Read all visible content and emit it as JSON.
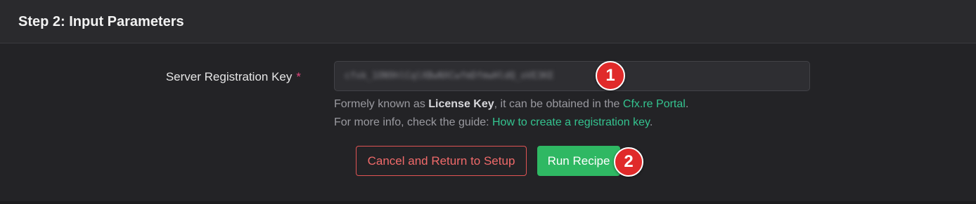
{
  "card": {
    "title": "Step 2: Input Parameters"
  },
  "form": {
    "key_label": "Server Registration Key",
    "required_mark": "*",
    "key_value": "cfxk_1ON9hlCqlXBwNXCwfmDfmwHldQ_oVE3KE"
  },
  "help": {
    "line1_prefix": "Formely known as ",
    "line1_bold": "License Key",
    "line1_middle": ", it can be obtained in the ",
    "line1_link": "Cfx.re Portal",
    "line1_suffix": ".",
    "line2_prefix": "For more info, check the guide: ",
    "line2_link": "How to create a registration key",
    "line2_suffix": "."
  },
  "actions": {
    "cancel_label": "Cancel and Return to Setup",
    "run_label": "Run Recipe"
  },
  "callouts": {
    "first": "1",
    "second": "2"
  },
  "colors": {
    "accent_green": "#2fb863",
    "link_green": "#34c38f",
    "danger_red": "#e05454",
    "callout_red": "#e02a2a",
    "required_pink": "#e0457b"
  }
}
